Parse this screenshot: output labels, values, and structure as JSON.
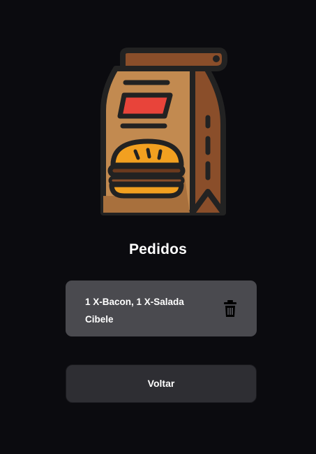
{
  "logo": {
    "icon": "burger-delivery-bag-icon"
  },
  "page": {
    "title": "Pedidos"
  },
  "orders": [
    {
      "items": "1 X-Bacon, 1 X-Salada",
      "customer": "Cibele",
      "delete_icon": "trash-icon"
    }
  ],
  "actions": {
    "back_label": "Voltar"
  },
  "colors": {
    "background": "#0b0b0f",
    "card": "#4a4a4f",
    "button": "#2e2e33",
    "bag_light": "#c28a50",
    "bag_dark": "#8a4e2a",
    "label_red": "#e8443a",
    "bun": "#f2a020"
  }
}
